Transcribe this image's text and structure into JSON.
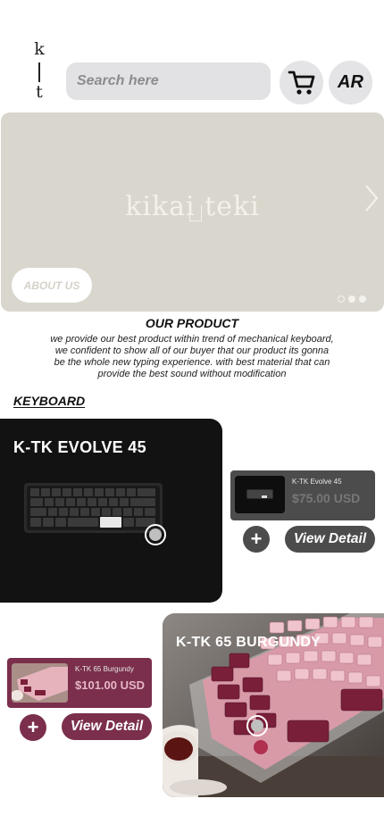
{
  "header": {
    "logo_top": "k",
    "logo_bottom": "t",
    "search_placeholder": "Search here",
    "cart_icon": "cart-icon",
    "language_label": "AR"
  },
  "hero": {
    "brand_text": "kikai teki",
    "next_icon": "chevron-right-icon",
    "about_label": "ABOUT US",
    "slides": 3,
    "active_slide": 1
  },
  "about": {
    "title": "OUR PRODUCT",
    "description": "we provide our best product within trend of mechanical keyboard, we confident to show all of our buyer that our product its gonna be the whole new typing experience. with best material that can provide the best sound without modification"
  },
  "category": {
    "label": "KEYBOARD"
  },
  "products": [
    {
      "title": "K-TK EVOLVE 45",
      "mini_name": "K-TK Evolve 45",
      "price": "$75.00 USD",
      "add_label": "+",
      "detail_label": "View Detail",
      "accent": "#4c4c4c"
    },
    {
      "title": "K-TK 65 BURGUNDY",
      "mini_name": "K-TK 65 Burgundy",
      "price": "$101.00 USD",
      "add_label": "+",
      "detail_label": "View Detail",
      "accent": "#7b2f4c"
    }
  ],
  "colors": {
    "hero_bg": "#d9d6cd",
    "dark_card": "#121212",
    "burgundy": "#7b2f4c",
    "gray_accent": "#4c4c4c"
  }
}
